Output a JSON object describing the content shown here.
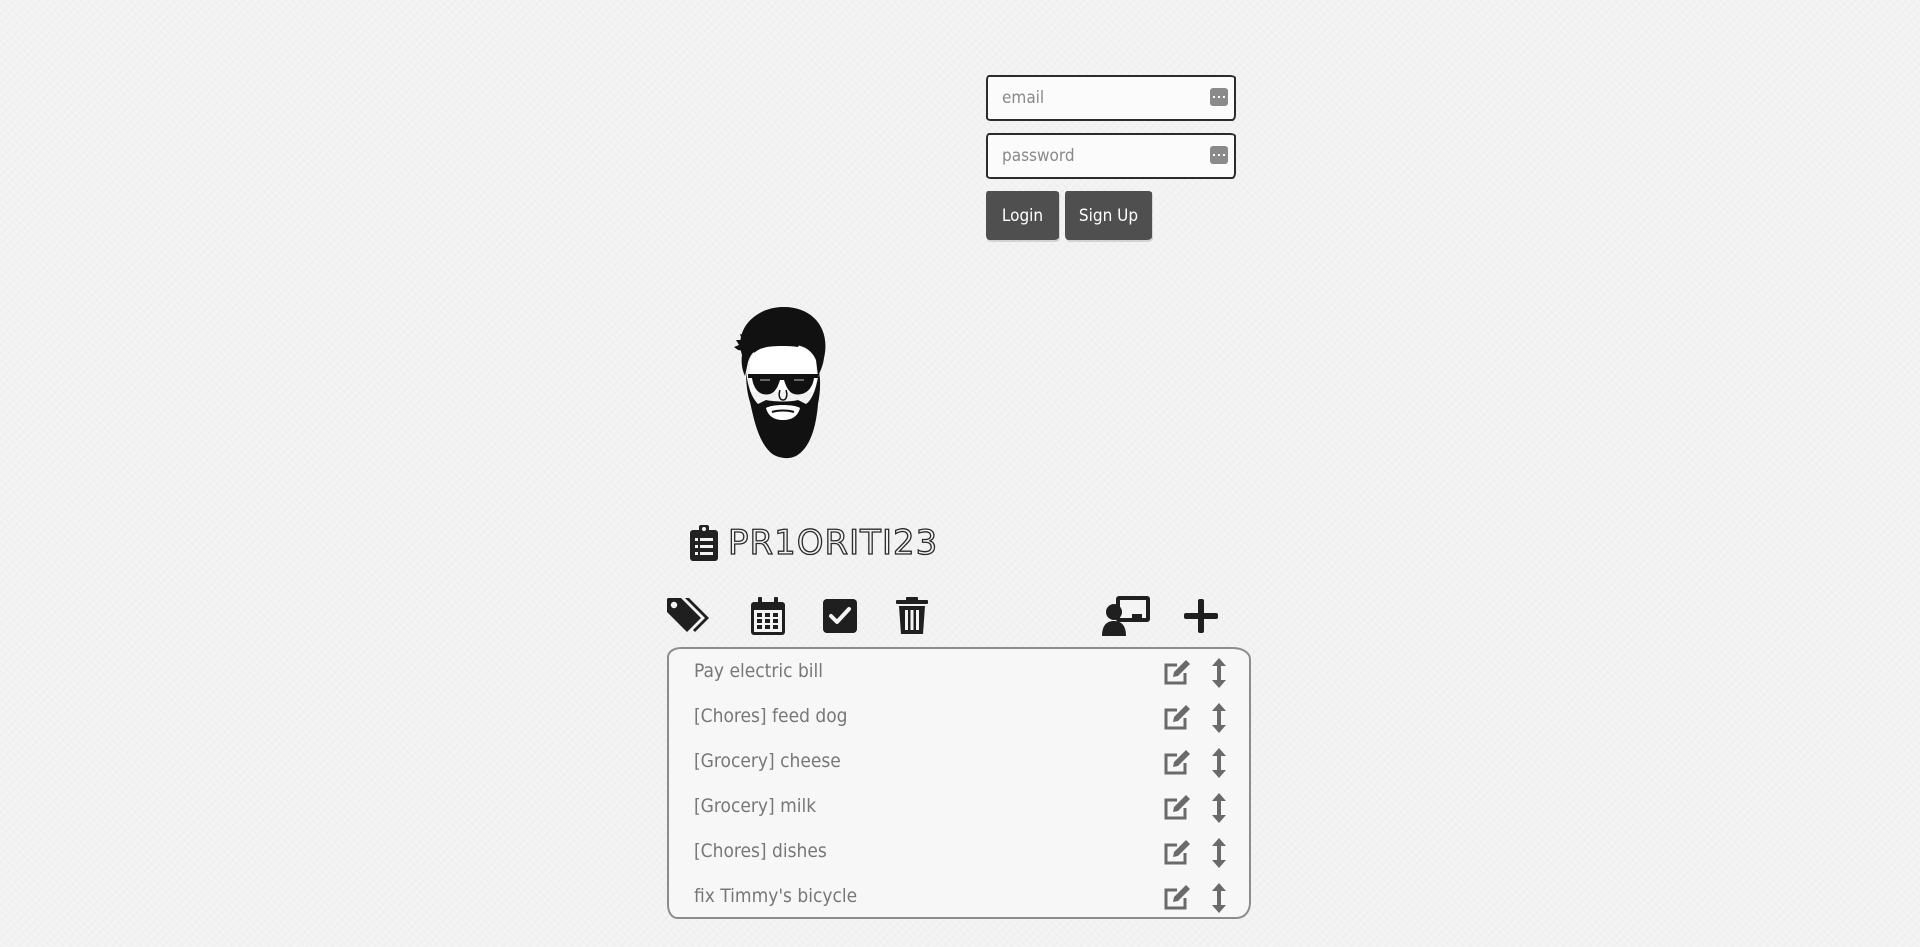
{
  "login": {
    "email_placeholder": "email",
    "email_value": "",
    "password_placeholder": "password",
    "password_value": "",
    "login_label": "Login",
    "signup_label": "Sign Up"
  },
  "avatar": {
    "icon": "bearded-man-sunglasses-avatar"
  },
  "brand": {
    "icon": "clipboard-list-icon",
    "title": "PR1ORITI23"
  },
  "toolbar": {
    "left": [
      "tags-icon",
      "calendar-icon",
      "check-square-icon",
      "trash-icon"
    ],
    "right": [
      "share-user-icon",
      "plus-icon"
    ]
  },
  "tasks": [
    {
      "text": "Pay electric bill"
    },
    {
      "text": "[Chores] feed dog"
    },
    {
      "text": "[Grocery] cheese"
    },
    {
      "text": "[Grocery] milk"
    },
    {
      "text": "[Chores] dishes"
    },
    {
      "text": "fix Timmy's bicycle"
    }
  ],
  "colors": {
    "background": "#f4f4f4",
    "button": "#4f4f4f",
    "icon": "#333333",
    "task_text": "#777777",
    "list_border": "#8c8c8c"
  }
}
